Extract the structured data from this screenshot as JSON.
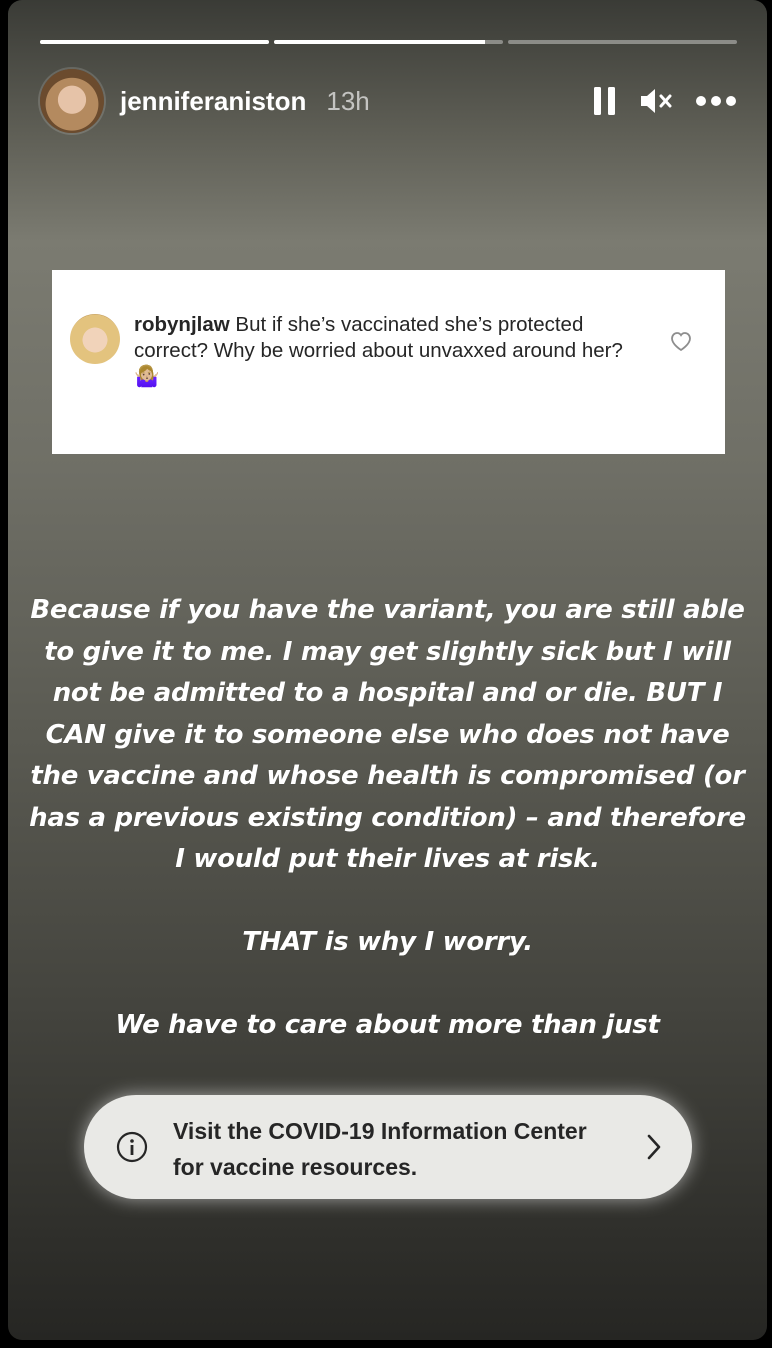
{
  "story": {
    "progress": [
      1.0,
      0.92,
      0.0
    ]
  },
  "header": {
    "username": "jenniferaniston",
    "time": "13h",
    "icons": [
      "pause-icon",
      "mute-icon",
      "more-icon"
    ]
  },
  "comment": {
    "username": "robynjlaw",
    "text": "But if she’s vaccinated she’s protected correct? Why be worried about unvaxxed around her? 🤷🏼‍♀️"
  },
  "story_text": {
    "paragraph1": "Because if you have the variant, you are still able to give it to me. I may get slightly sick but I will not be admitted to a hospital and or die. BUT I CAN give it to someone else who does not have the vaccine and whose health is compromised (or has a previous existing condition) – and therefore I would put their lives at risk.",
    "paragraph2": "THAT is why I worry.",
    "paragraph3": "We have to care about more than just"
  },
  "info_banner": {
    "text": "Visit the COVID-19 Information Center for vaccine resources."
  }
}
